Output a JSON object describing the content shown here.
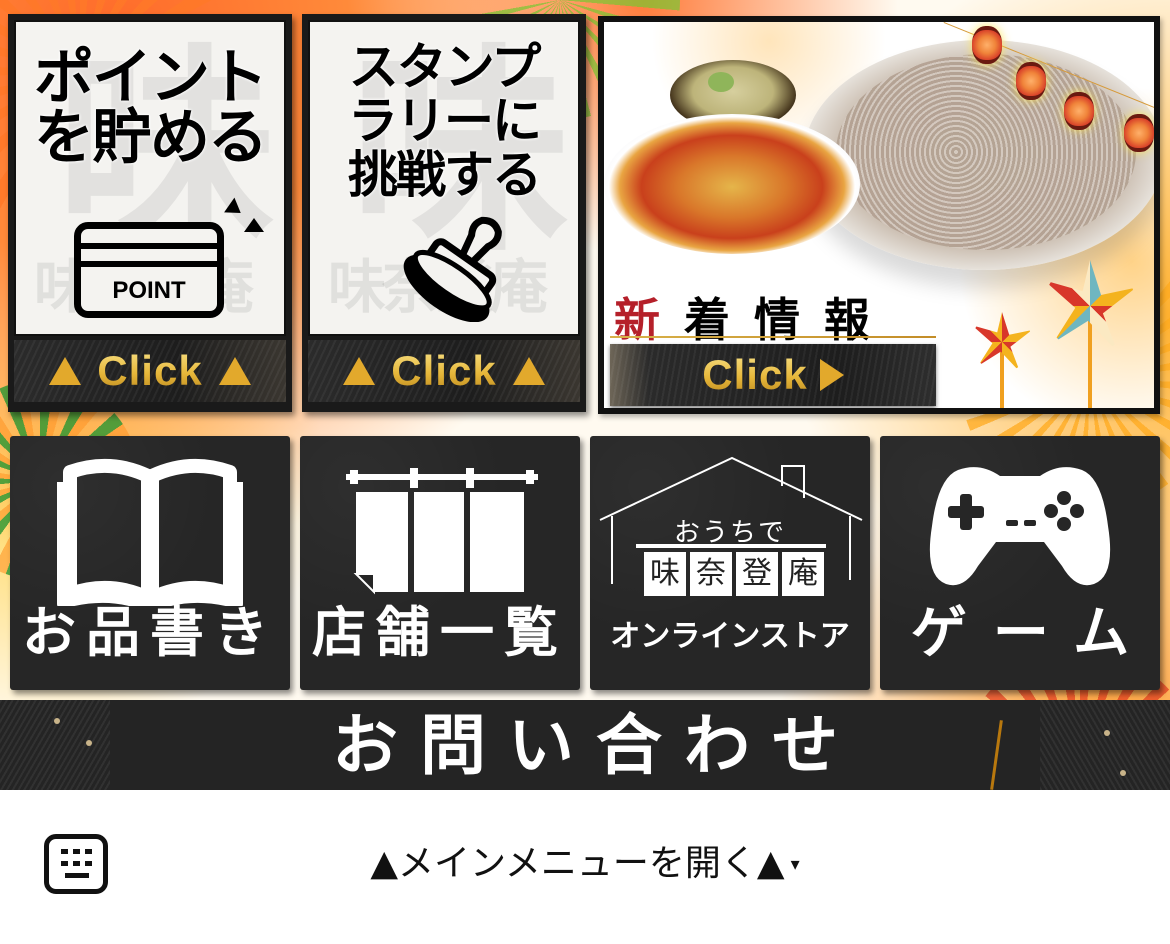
{
  "rich_menu": {
    "cards": [
      {
        "id": "points",
        "title_lines": [
          "ポイント",
          "を貯める"
        ],
        "icon": "point-card-icon",
        "icon_label": "POINT",
        "button_label": "Click"
      },
      {
        "id": "stamp-rally",
        "title_lines": [
          "スタンプ",
          "ラリーに",
          "挑戦する"
        ],
        "icon": "stamp-icon",
        "button_label": "Click"
      },
      {
        "id": "news",
        "title_accent": "新",
        "title_rest": "着情報",
        "icon": "soba-photo",
        "button_label": "Click"
      }
    ],
    "tiles": [
      {
        "id": "menu",
        "label": "お品書き",
        "icon": "open-book-icon"
      },
      {
        "id": "stores",
        "label": "店舗一覧",
        "icon": "noren-curtain-icon"
      },
      {
        "id": "online-store",
        "label": "オンラインストア",
        "icon": "house-icon",
        "icon_sub": "おうちで",
        "icon_brand": [
          "味",
          "奈",
          "登",
          "庵"
        ]
      },
      {
        "id": "game",
        "label": "ゲーム",
        "icon": "gamepad-icon"
      }
    ],
    "watermark_brand": "味奈登庵",
    "watermark_big": "味",
    "contact_label": "お問い合わせ",
    "colors": {
      "gold": "#e2a92c",
      "tile_bg": "#262626",
      "news_accent": "#b5202a"
    }
  },
  "chat_bar": {
    "keyboard_icon": "keyboard-icon",
    "menu_toggle_label": "▲メインメニューを開く▲",
    "menu_toggle_chevron": "▾"
  }
}
